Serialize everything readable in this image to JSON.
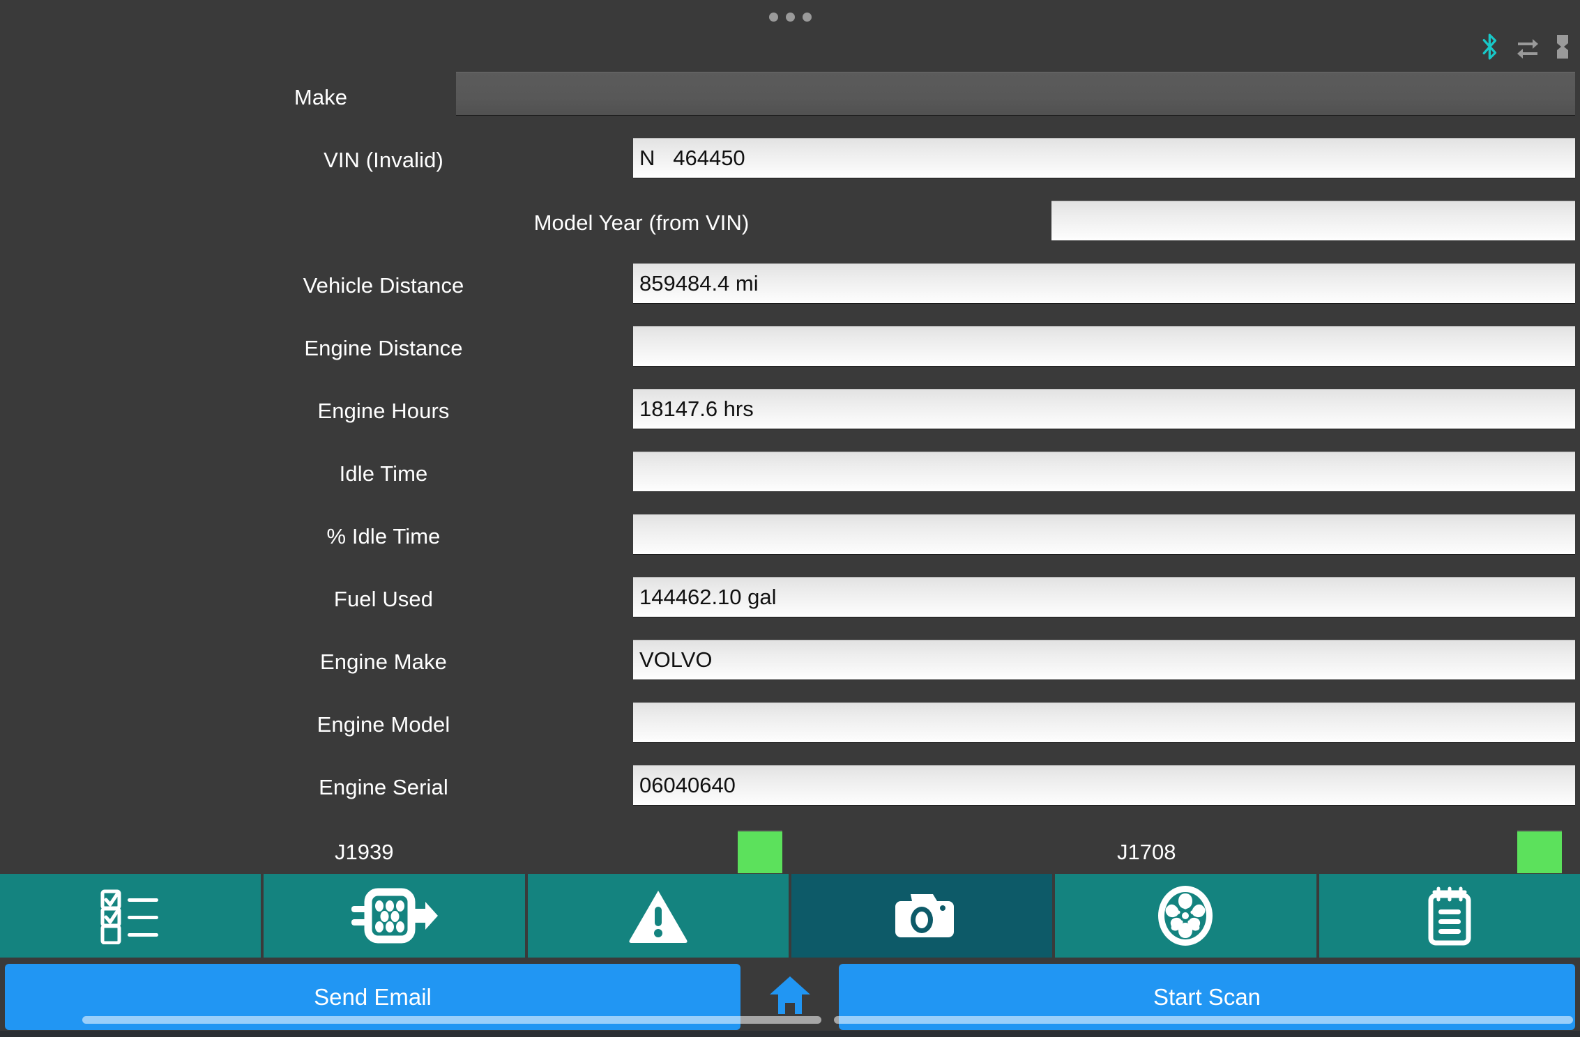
{
  "window": {
    "background_color": "#3a3a3a",
    "overflow_menu_label": "more-options"
  },
  "status_bar": {
    "icons": [
      {
        "name": "bluetooth-icon",
        "color": "#18c8c8",
        "label": "Bluetooth"
      },
      {
        "name": "data-transfer-icon",
        "color": "#9a9a9a",
        "label": "Data transfer"
      },
      {
        "name": "battery-icon",
        "color": "#9a9a9a",
        "label": "Battery"
      }
    ]
  },
  "form": {
    "rows": [
      {
        "label": "Make",
        "value": "",
        "disabled": true
      },
      {
        "label": "VIN (Invalid)",
        "value": "N   464450",
        "disabled": false
      },
      {
        "label": "Model Year (from VIN)",
        "value": "",
        "disabled": false
      },
      {
        "label": "Vehicle Distance",
        "value": "859484.4 mi",
        "disabled": false
      },
      {
        "label": "Engine Distance",
        "value": "",
        "disabled": false
      },
      {
        "label": "Engine Hours",
        "value": "18147.6 hrs",
        "disabled": false
      },
      {
        "label": "Idle Time",
        "value": "",
        "disabled": false
      },
      {
        "label": "% Idle Time",
        "value": "",
        "disabled": false
      },
      {
        "label": "Fuel Used",
        "value": "144462.10 gal",
        "disabled": false
      },
      {
        "label": "Engine Make",
        "value": "VOLVO",
        "disabled": false
      },
      {
        "label": "Engine Model",
        "value": "",
        "disabled": false
      },
      {
        "label": "Engine Serial",
        "value": "06040640",
        "disabled": false
      }
    ]
  },
  "protocols": {
    "indicator_color": "#5ce15c",
    "items": [
      {
        "label": "J1939",
        "status": "active"
      },
      {
        "label": "J1708",
        "status": "active"
      }
    ]
  },
  "tab_bar": {
    "background_color": "#14837f",
    "active_background_color": "#0d5a68",
    "tabs": [
      {
        "icon": "checklist-icon",
        "label": "Checklist",
        "active": false
      },
      {
        "icon": "connector-icon",
        "label": "Connector",
        "active": false
      },
      {
        "icon": "warning-icon",
        "label": "Faults",
        "active": false
      },
      {
        "icon": "camera-icon",
        "label": "Camera",
        "active": true
      },
      {
        "icon": "wheel-icon",
        "label": "Wheel",
        "active": false
      },
      {
        "icon": "notepad-icon",
        "label": "Notes",
        "active": false
      }
    ]
  },
  "action_bar": {
    "accent_color": "#2196f3",
    "send_email_label": "Send Email",
    "start_scan_label": "Start Scan",
    "home_icon": "home-icon"
  }
}
